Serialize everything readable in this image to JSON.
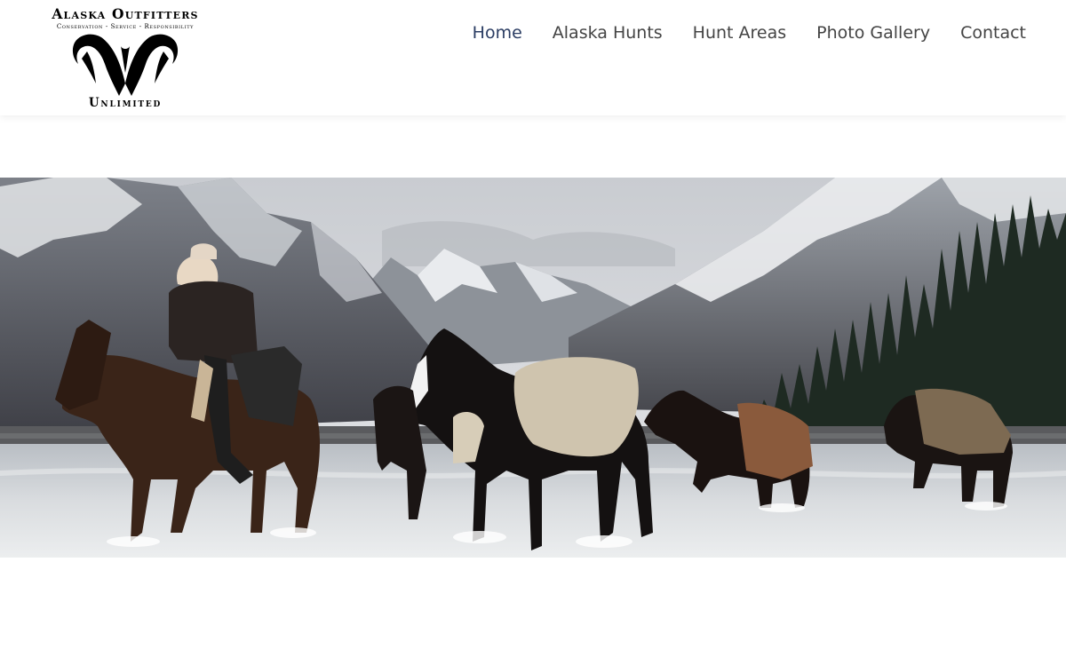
{
  "site": {
    "logo": {
      "line1": "Alaska Outfitters",
      "tagline": "Conservation - Service - Responsibility",
      "line2": "Unlimited",
      "emblem_icon": "ram-horns-icon"
    }
  },
  "nav": {
    "items": [
      {
        "label": "Home",
        "active": true
      },
      {
        "label": "Alaska Hunts",
        "active": false
      },
      {
        "label": "Hunt Areas",
        "active": false
      },
      {
        "label": "Photo Gallery",
        "active": false
      },
      {
        "label": "Contact",
        "active": false
      }
    ]
  },
  "colors": {
    "nav_active": "#2b3d63",
    "nav_text": "#444444",
    "background": "#ffffff"
  }
}
